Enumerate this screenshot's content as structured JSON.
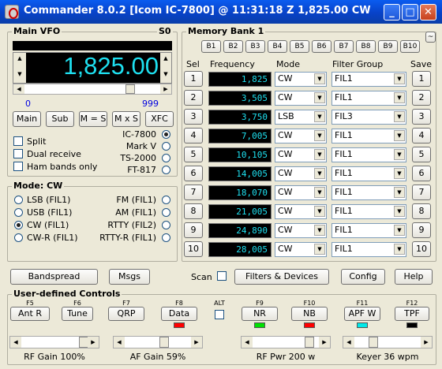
{
  "title": "Commander 8.0.2 [Icom IC-7800] @ 11:31:18 Z  1,825.00 CW",
  "window_controls": {
    "minimize": "_",
    "maximize": "□",
    "close": "✕"
  },
  "vfo": {
    "title": "Main VFO",
    "s_meter": "S0",
    "frequency": "1,825.00",
    "scale_min": "0",
    "scale_max": "999",
    "buttons": [
      "Main",
      "Sub",
      "M = S",
      "M x S",
      "XFC"
    ]
  },
  "options": [
    "Split",
    "Dual receive",
    "Ham bands only"
  ],
  "radios": [
    "IC-7800",
    "Mark V",
    "TS-2000",
    "FT-817"
  ],
  "mode": {
    "title": "Mode: CW",
    "left": [
      "LSB (FIL1)",
      "USB (FIL1)",
      "CW (FIL1)",
      "CW-R (FIL1)"
    ],
    "right": [
      "FM (FIL1)",
      "AM (FIL1)",
      "RTTY (FIL2)",
      "RTTY-R (FIL1)"
    ]
  },
  "memory": {
    "title": "Memory Bank 1",
    "banks": [
      "B1",
      "B2",
      "B3",
      "B4",
      "B5",
      "B6",
      "B7",
      "B8",
      "B9",
      "B10"
    ],
    "headers": {
      "sel": "Sel",
      "freq": "Frequency",
      "mode": "Mode",
      "filter": "Filter Group",
      "save": "Save"
    },
    "rows": [
      {
        "n": "1",
        "f": "1,825",
        "m": "CW",
        "fg": "FIL1"
      },
      {
        "n": "2",
        "f": "3,505",
        "m": "CW",
        "fg": "FIL1"
      },
      {
        "n": "3",
        "f": "3,750",
        "m": "LSB",
        "fg": "FIL3"
      },
      {
        "n": "4",
        "f": "7,005",
        "m": "CW",
        "fg": "FIL1"
      },
      {
        "n": "5",
        "f": "10,105",
        "m": "CW",
        "fg": "FIL1"
      },
      {
        "n": "6",
        "f": "14,005",
        "m": "CW",
        "fg": "FIL1"
      },
      {
        "n": "7",
        "f": "18,070",
        "m": "CW",
        "fg": "FIL1"
      },
      {
        "n": "8",
        "f": "21,005",
        "m": "CW",
        "fg": "FIL1"
      },
      {
        "n": "9",
        "f": "24,890",
        "m": "CW",
        "fg": "FIL1"
      },
      {
        "n": "10",
        "f": "28,005",
        "m": "CW",
        "fg": "FIL1"
      }
    ]
  },
  "toolbar": {
    "bandspread": "Bandspread",
    "msgs": "Msgs",
    "scan": "Scan",
    "filters": "Filters & Devices",
    "config": "Config",
    "help": "Help"
  },
  "udc": {
    "title": "User-defined Controls",
    "alt": "ALT",
    "keys": [
      {
        "fk": "F5",
        "label": "Ant R"
      },
      {
        "fk": "F6",
        "label": "Tune"
      },
      {
        "fk": "F7",
        "label": "QRP"
      },
      {
        "fk": "F8",
        "label": "Data",
        "led": "#ff0000"
      },
      {
        "fk": "F9",
        "label": "NR",
        "led": "#00e000"
      },
      {
        "fk": "F10",
        "label": "NB",
        "led": "#ff0000"
      },
      {
        "fk": "F11",
        "label": "APF W",
        "led": "#00e8e8"
      },
      {
        "fk": "F12",
        "label": "TPF",
        "led": "#000000"
      }
    ],
    "sliders": [
      "RF Gain 100%",
      "AF Gain 59%",
      "RF Pwr 200 w",
      "Keyer 36 wpm"
    ]
  }
}
